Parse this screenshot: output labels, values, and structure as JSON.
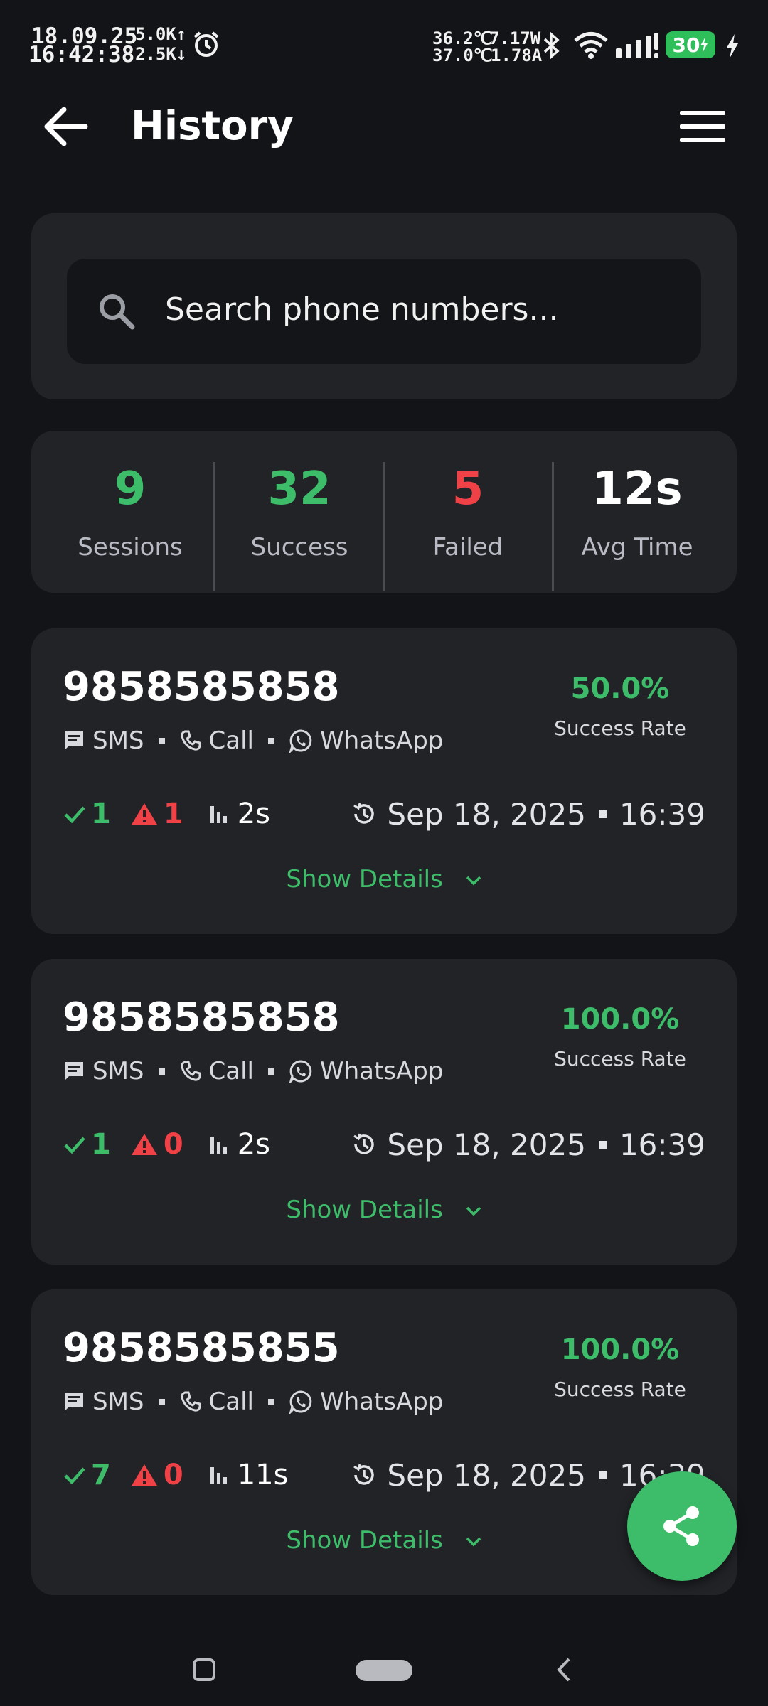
{
  "status_bar": {
    "date": "18.09.25",
    "time": "16:42:38",
    "net_up": "5.0K↑",
    "net_down": "2.5K↓",
    "temp1": "36.2℃",
    "temp2": "37.0℃",
    "power": "7.17W",
    "current": "1.78A",
    "battery": "30"
  },
  "header": {
    "title": "History"
  },
  "search": {
    "placeholder": "Search phone numbers..."
  },
  "stats": [
    {
      "value": "9",
      "label": "Sessions",
      "color": "#3dbd6a"
    },
    {
      "value": "32",
      "label": "Success",
      "color": "#3dbd6a"
    },
    {
      "value": "5",
      "label": "Failed",
      "color": "#ef4146"
    },
    {
      "value": "12s",
      "label": "Avg Time",
      "color": "#ffffff"
    }
  ],
  "channels": {
    "sms": "SMS",
    "call": "Call",
    "whatsapp": "WhatsApp"
  },
  "sessions": [
    {
      "phone": "9858585858",
      "rate": "50.0%",
      "rate_label": "Success Rate",
      "success": "1",
      "failed": "1",
      "duration": "2s",
      "date": "Sep 18, 2025",
      "time": "16:39",
      "details": "Show Details"
    },
    {
      "phone": "9858585858",
      "rate": "100.0%",
      "rate_label": "Success Rate",
      "success": "1",
      "failed": "0",
      "duration": "2s",
      "date": "Sep 18, 2025",
      "time": "16:39",
      "details": "Show Details"
    },
    {
      "phone": "9858585855",
      "rate": "100.0%",
      "rate_label": "Success Rate",
      "success": "7",
      "failed": "0",
      "duration": "11s",
      "date": "Sep 18, 2025",
      "time": "16:39",
      "details": "Show Details"
    }
  ],
  "colors": {
    "accent": "#3dbd6a",
    "danger": "#ef4146",
    "card": "#222327",
    "background": "#131418"
  },
  "icons": [
    "back-arrow-icon",
    "menu-icon",
    "search-icon",
    "sms-icon",
    "phone-icon",
    "whatsapp-icon",
    "check-icon",
    "warning-icon",
    "bar-chart-icon",
    "history-icon",
    "chevron-down-icon",
    "share-icon"
  ]
}
